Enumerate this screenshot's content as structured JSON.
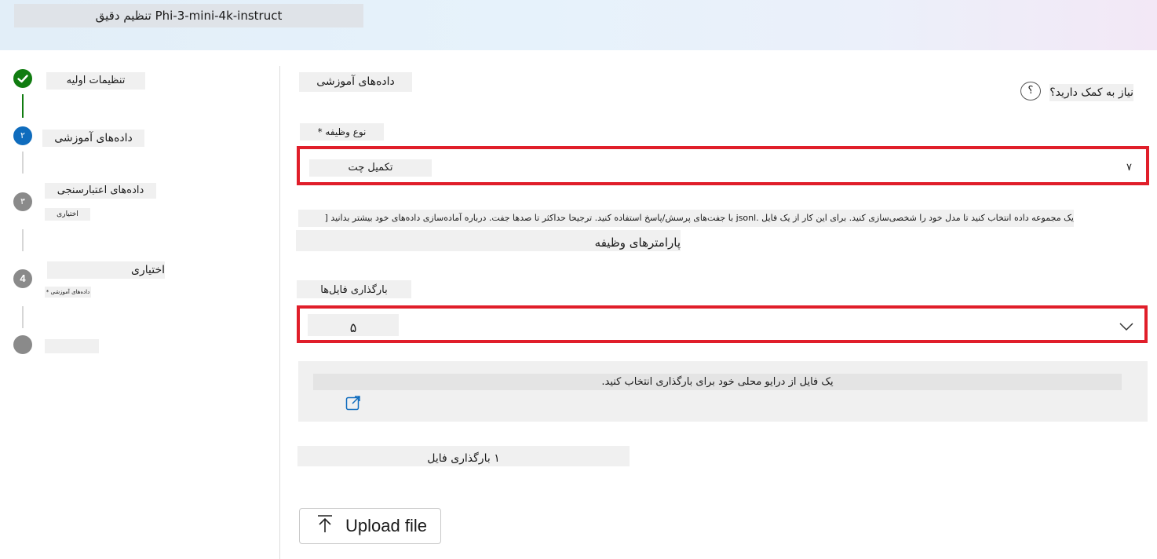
{
  "header": {
    "title": "Phi-3-mini-4k-instruct تنظیم دقیق"
  },
  "steps": [
    {
      "number": "",
      "label": "تنظیمات اولیه",
      "status": "completed"
    },
    {
      "number": "۲",
      "label": "داده‌های آموزشی",
      "status": "active"
    },
    {
      "number": "۳",
      "label": "داده‌های اعتبارسنجی",
      "sublabel": "اختیاری",
      "status": "pending"
    },
    {
      "number": "4",
      "label": "اختیاری",
      "sublabel": "داده‌های آموزشی *",
      "status": "pending"
    },
    {
      "number": "",
      "label": "",
      "status": "pending"
    }
  ],
  "main": {
    "section_title": "داده‌های آموزشی",
    "help_text": "نیاز به کمک دارید؟",
    "help_icon_glyph": "؟",
    "task_type_label": "نوع وظیفه *",
    "task_type_value": "تکمیل چت",
    "task_type_marker": "۷",
    "description": "یک مجموعه داده انتخاب کنید تا مدل خود را شخصی‌سازی کنید. برای این کار از یک فایل .jsonl با جفت‌های پرسش/پاسخ استفاده کنید. ترجیحا حداکثر تا صدها جفت. درباره آماده‌سازی داده‌های خود بیشتر بدانید [",
    "task_params_label": "پارامترهای وظیفه",
    "upload_files_label": "بارگذاری فایل‌ها",
    "upload_select_value": "۵",
    "local_file_text": "یک فایل از درایو محلی خود برای بارگذاری انتخاب کنید.",
    "upload_file_label": "۱ بارگذاری فایل",
    "upload_button": "Upload file"
  },
  "colors": {
    "completed": "#107c10",
    "active": "#0f6cbd",
    "pending": "#8a8a8a",
    "highlight": "#e01e2a"
  }
}
